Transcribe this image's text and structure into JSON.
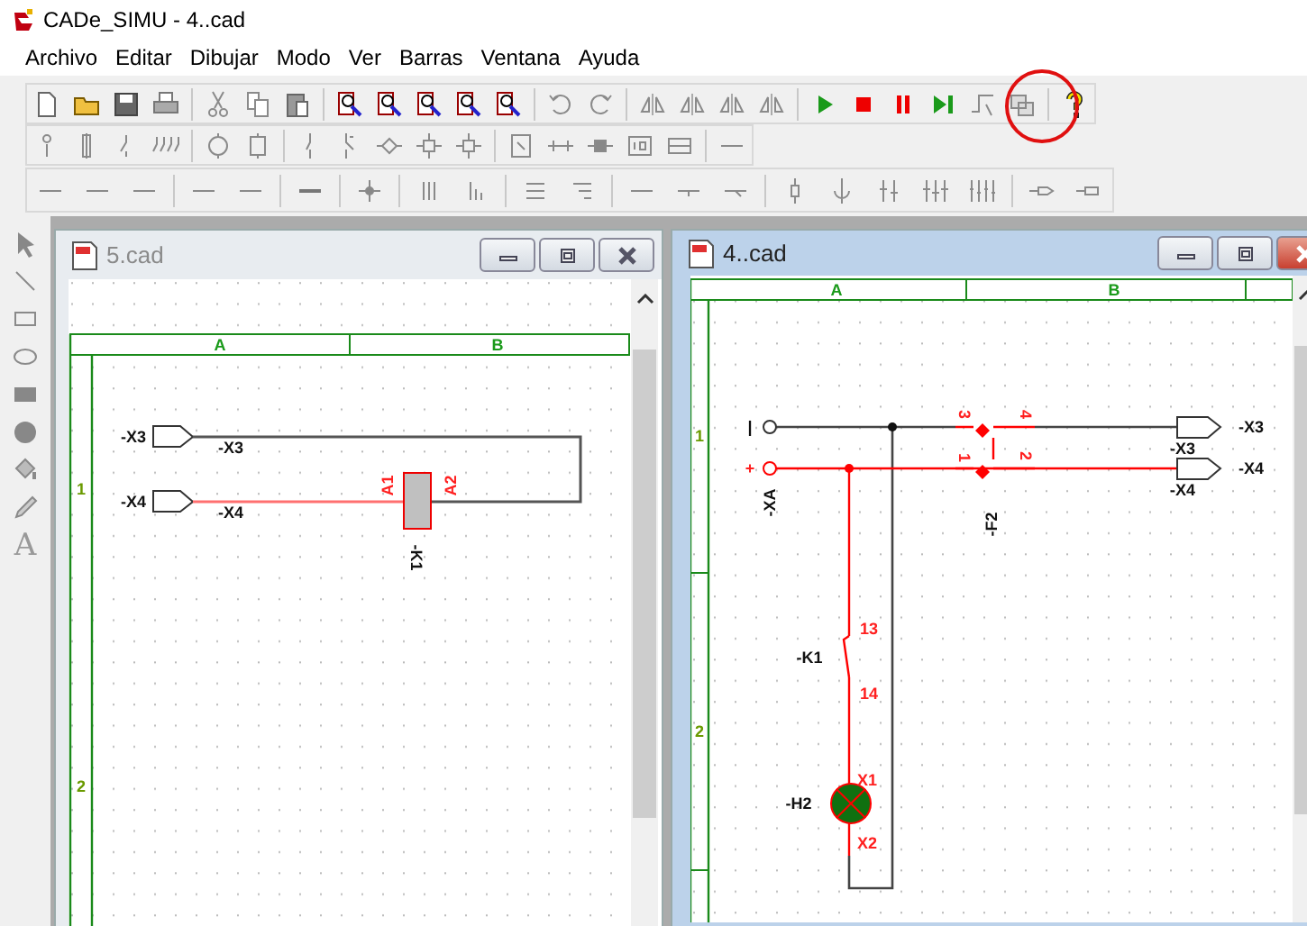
{
  "app": {
    "title": "CADe_SIMU - 4..cad"
  },
  "menu": [
    "Archivo",
    "Editar",
    "Dibujar",
    "Modo",
    "Ver",
    "Barras",
    "Ventana",
    "Ayuda"
  ],
  "side_toolbar": {
    "text_tool": "A"
  },
  "windows": [
    {
      "title": "5.cad",
      "active": false,
      "columns": [
        "A",
        "B"
      ],
      "rows": [
        "1",
        "2"
      ],
      "labels": [
        "-X3",
        "-X3",
        "-X4",
        "-X4",
        "A1",
        "A2",
        "-K1"
      ]
    },
    {
      "title": "4..cad",
      "active": true,
      "columns": [
        "A",
        "B"
      ],
      "rows": [
        "1",
        "2"
      ],
      "labels": [
        "|",
        "+",
        "-XA",
        "3",
        "4",
        "1",
        "2",
        "-F2",
        "-X3",
        "-X3",
        "-X4",
        "-X4",
        "13",
        "-K1",
        "14",
        "X1",
        "-H2",
        "X2"
      ]
    }
  ]
}
